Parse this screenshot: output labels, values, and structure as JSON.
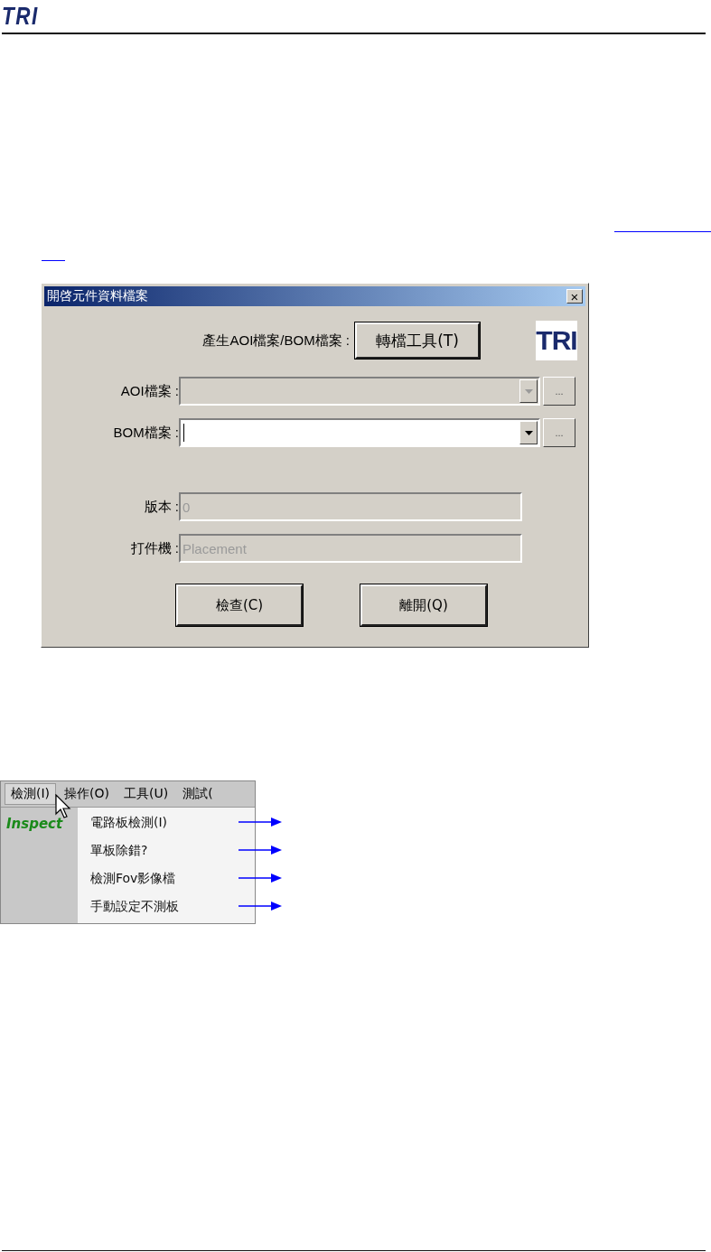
{
  "header": {
    "logo": "TRI"
  },
  "dialog": {
    "title": "開啓元件資料檔案",
    "close": "×",
    "logo": "TRI",
    "generate": {
      "label": "產生AOI檔案/BOM檔案 :",
      "button": "轉檔工具(T)"
    },
    "fields": [
      {
        "kind": "combo",
        "label": "AOI檔案 :",
        "disabled": true,
        "focused": false,
        "browse": "..."
      },
      {
        "kind": "combo",
        "label": "BOM檔案 :",
        "disabled": false,
        "focused": true,
        "browse": "..."
      },
      {
        "kind": "text",
        "label": "版本 :",
        "value": "0",
        "disabled": true
      },
      {
        "kind": "text",
        "label": "打件機 :",
        "value": "Placement",
        "disabled": true
      }
    ],
    "buttons": [
      "檢查(C)",
      "離開(Q)"
    ]
  },
  "menu": {
    "bar": [
      {
        "label": "檢測(I)",
        "selected": true
      },
      {
        "label": "操作(O)",
        "selected": false
      },
      {
        "label": "工具(U)",
        "selected": false
      },
      {
        "label": "測試(",
        "selected": false
      }
    ],
    "side_label": "Inspect",
    "items": [
      {
        "label": "電路板檢測(I)",
        "annotated": true
      },
      {
        "label": "單板除錯?",
        "annotated": true
      },
      {
        "label": "檢測Fov影像檔",
        "annotated": true
      },
      {
        "label": "手動設定不測板",
        "annotated": true
      }
    ]
  }
}
